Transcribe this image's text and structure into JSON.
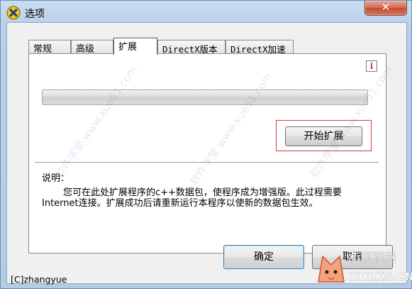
{
  "window": {
    "title": "选项",
    "close_label": "✕"
  },
  "tabs": [
    {
      "label": "常规",
      "active": false
    },
    {
      "label": "高级",
      "active": false
    },
    {
      "label": "扩展",
      "active": true
    },
    {
      "label": "DirectX版本",
      "active": false
    },
    {
      "label": "DirectX加速",
      "active": false
    }
  ],
  "panel": {
    "info_icon": "i",
    "progress": {
      "value": 0
    },
    "start_button": "开始扩展",
    "description_label": "说明：",
    "description_text": "您可在此处扩展程序的c++数据包，使程序成为增强版。此过程需要Internet连接。扩展成功后请重新运行本程序以使新的数据包生效。"
  },
  "buttons": {
    "ok": "确定",
    "cancel": "取消"
  },
  "footer": {
    "copyright": "[C]zhangyue"
  },
  "watermark": {
    "badge_text": "小狐狸网",
    "badge_url": "XHLKS.CN"
  },
  "colors": {
    "accent": "#3c7fb1",
    "highlight": "#d23c3c",
    "close": "#c44a2e"
  }
}
